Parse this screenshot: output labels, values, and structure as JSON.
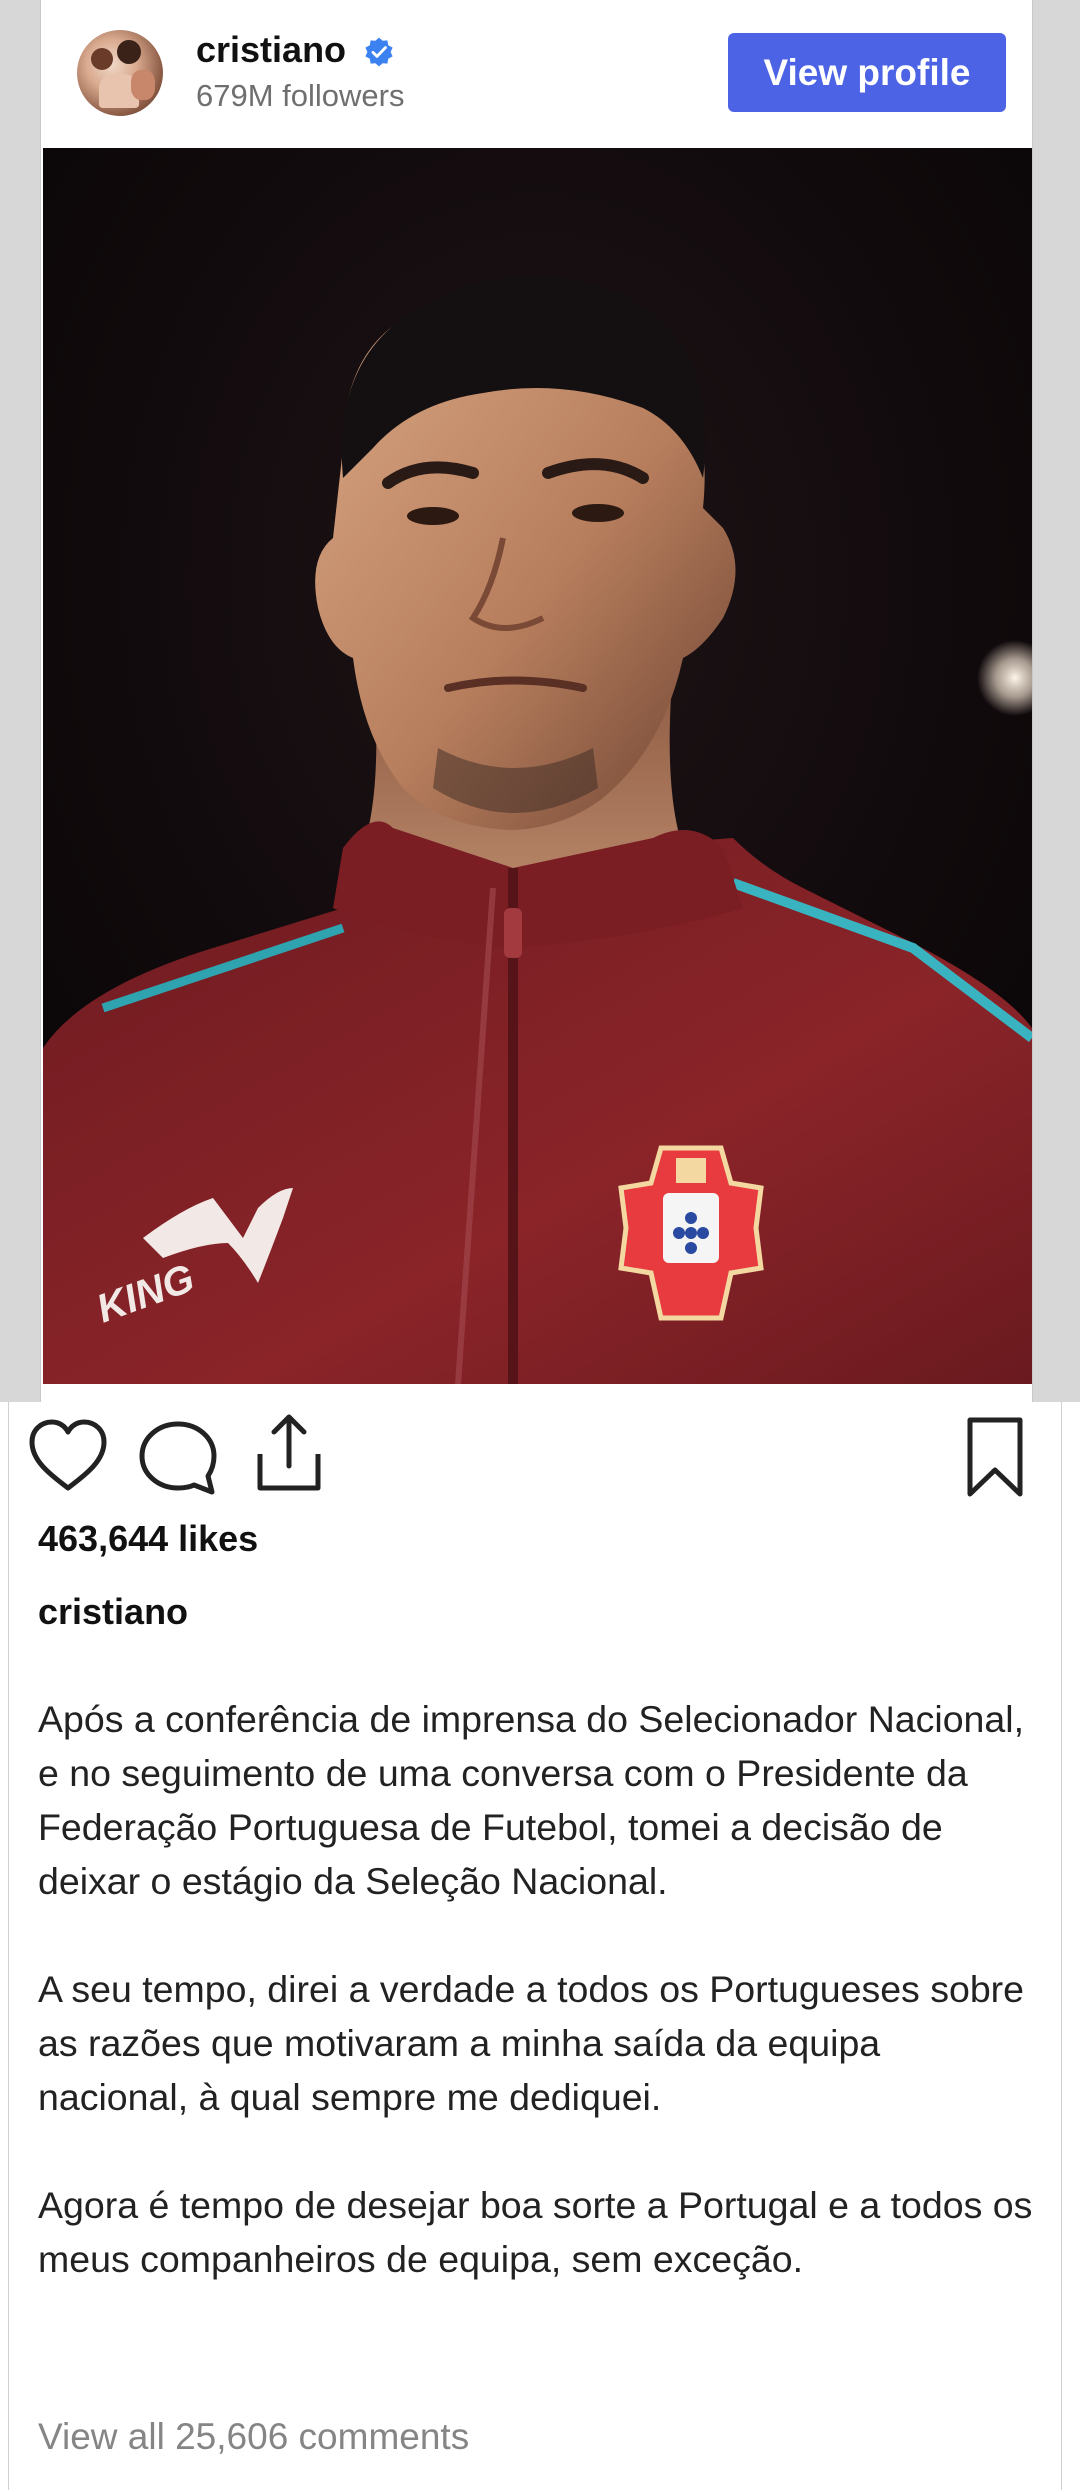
{
  "header": {
    "username": "cristiano",
    "followers": "679M followers",
    "view_profile_label": "View profile"
  },
  "post": {
    "likes": "463,644 likes",
    "caption_user": "cristiano",
    "caption_paragraphs": [
      "Após a conferência de imprensa do Selecionador Nacional, e no seguimento de uma conversa com o Presidente da Federação Portuguesa de Futebol, tomei a decisão de deixar o estágio da Seleção Nacional.",
      "A seu tempo, direi a verdade a todos os Portugueses sobre as razões que motivaram a minha saída da equipa nacional, à qual sempre me dediquei.",
      "Agora é tempo de desejar boa sorte a Portugal e a todos os meus companheiros de equipa, sem exceção."
    ],
    "view_comments": "View all 25,606 comments",
    "photo_jacket_text": "KING"
  },
  "icons": {
    "verified": "verified-badge-icon",
    "like": "heart-icon",
    "comment": "comment-bubble-icon",
    "share": "share-icon",
    "bookmark": "bookmark-icon"
  },
  "colors": {
    "accent_button": "#4d63e6",
    "verified": "#3b82f0",
    "muted_text": "#6f6f6f"
  }
}
